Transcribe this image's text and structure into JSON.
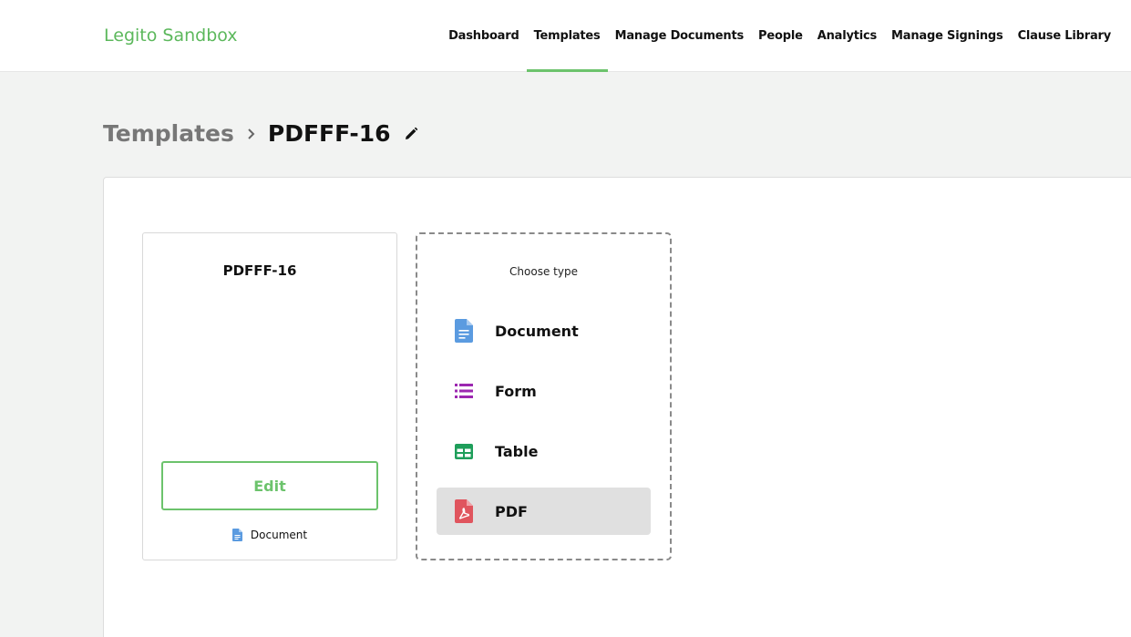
{
  "header": {
    "brand": "Legito Sandbox",
    "nav": [
      "Dashboard",
      "Templates",
      "Manage Documents",
      "People",
      "Analytics",
      "Manage Signings",
      "Clause Library"
    ],
    "active_nav": "Templates"
  },
  "breadcrumb": {
    "parent": "Templates",
    "current": "PDFFF-16"
  },
  "template_card": {
    "title": "PDFFF-16",
    "edit_label": "Edit",
    "type_label": "Document",
    "type_icon": "document-icon"
  },
  "type_chooser": {
    "title": "Choose type",
    "options": [
      {
        "label": "Document",
        "icon": "document-icon",
        "color": "#5b9be0"
      },
      {
        "label": "Form",
        "icon": "list-icon",
        "color": "#9c27b0"
      },
      {
        "label": "Table",
        "icon": "table-icon",
        "color": "#1e9e5a"
      },
      {
        "label": "PDF",
        "icon": "pdf-icon",
        "color": "#e0555e"
      }
    ],
    "selected": "PDF"
  },
  "colors": {
    "accent": "#6cc36c",
    "brand": "#5cb85c"
  }
}
